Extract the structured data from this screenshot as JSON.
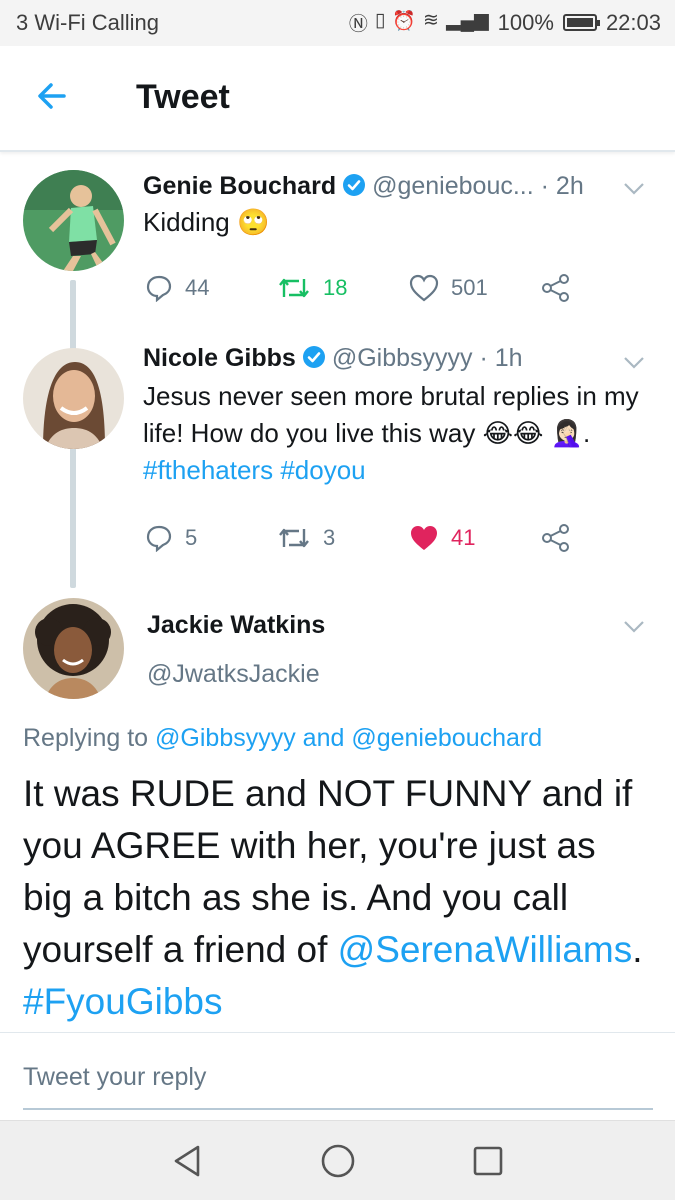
{
  "status_bar": {
    "carrier": "3 Wi-Fi Calling",
    "icons": [
      "nfc-icon",
      "vibrate-icon",
      "alarm-icon",
      "wifi-icon",
      "signal-icon"
    ],
    "battery": "100%",
    "time": "22:03"
  },
  "app_bar": {
    "title": "Tweet"
  },
  "tweets": [
    {
      "name": "Genie Bouchard",
      "handle": "@geniebouc...",
      "time": "· 2h",
      "text": "Kidding",
      "emoji": "🙄",
      "replies": "44",
      "retweets": "18",
      "likes": "501"
    },
    {
      "name": "Nicole Gibbs",
      "handle": "@Gibbsyyyy",
      "time": "· 1h",
      "text": "Jesus never seen more brutal replies in my life! How do you live this way 😂😂",
      "text2_emoji": "🤦🏻‍♀️",
      "text2_sep": ".",
      "hashtag1": "#fthehaters",
      "hashtag2": "#doyou",
      "replies": "5",
      "retweets": "3",
      "likes": "41"
    }
  ],
  "main_tweet": {
    "name": "Jackie Watkins",
    "handle": "@JwatksJackie",
    "replying_prefix": "Replying to",
    "replying_user1": "@Gibbsyyyy",
    "replying_and": "and",
    "replying_user2": "@geniebouchard",
    "text_main": "It was RUDE and NOT FUNNY and if you AGREE with her, you're just as big a bitch as she is. And you call  yourself a friend of",
    "mention": "@SerenaWilliams",
    "period": ".",
    "hashtag": "#FyouGibbs"
  },
  "reply_placeholder": "Tweet your reply",
  "colors": {
    "accent": "#1da1f2",
    "retweet": "#17bf63",
    "like": "#e0245e",
    "secondary_text": "#657786"
  }
}
